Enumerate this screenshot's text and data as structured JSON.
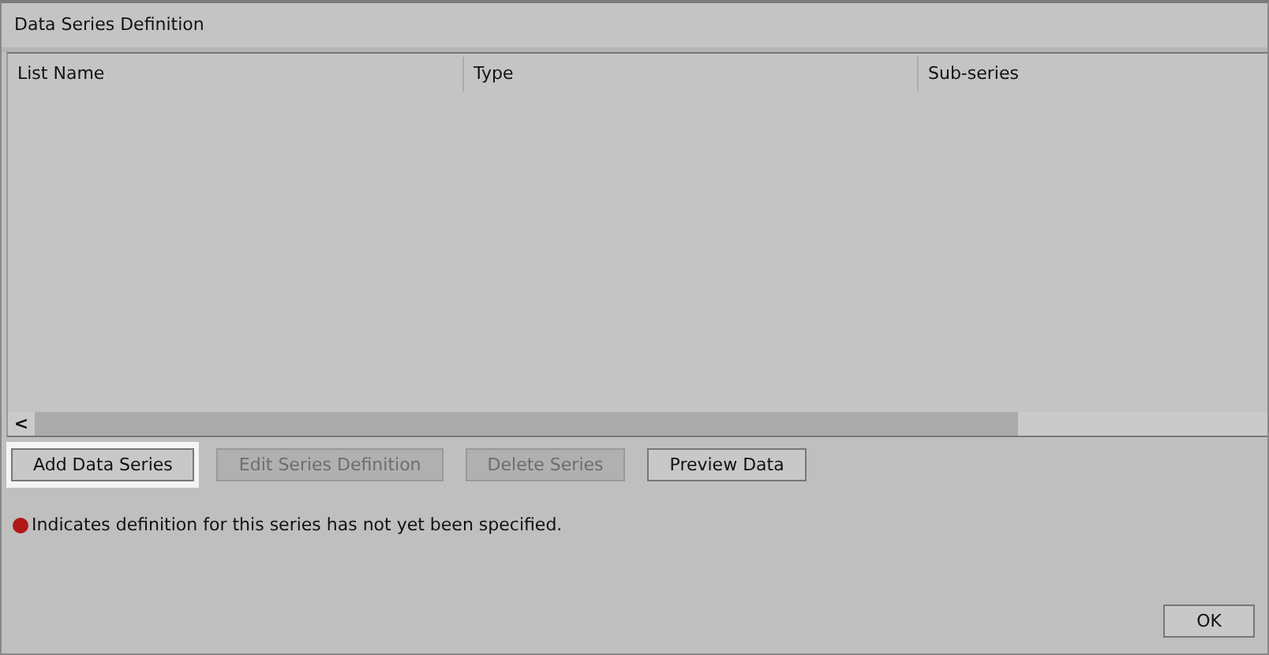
{
  "window": {
    "title": "Data Series Definition"
  },
  "table": {
    "columns": [
      {
        "label": "List Name"
      },
      {
        "label": "Type"
      },
      {
        "label": "Sub-series"
      }
    ]
  },
  "scroll_left": "<",
  "buttons": [
    {
      "label": "Add Data Series",
      "disabled": false,
      "focused": true
    },
    {
      "label": "Edit Series Definition",
      "disabled": true,
      "focused": false
    },
    {
      "label": "Delete Series",
      "disabled": true,
      "focused": false
    },
    {
      "label": "Preview Data",
      "disabled": false,
      "focused": false
    }
  ],
  "legend": {
    "color": "#b01818",
    "text": "Indicates definition for this series has not yet been specified."
  },
  "ok_button": {
    "label": "OK"
  }
}
